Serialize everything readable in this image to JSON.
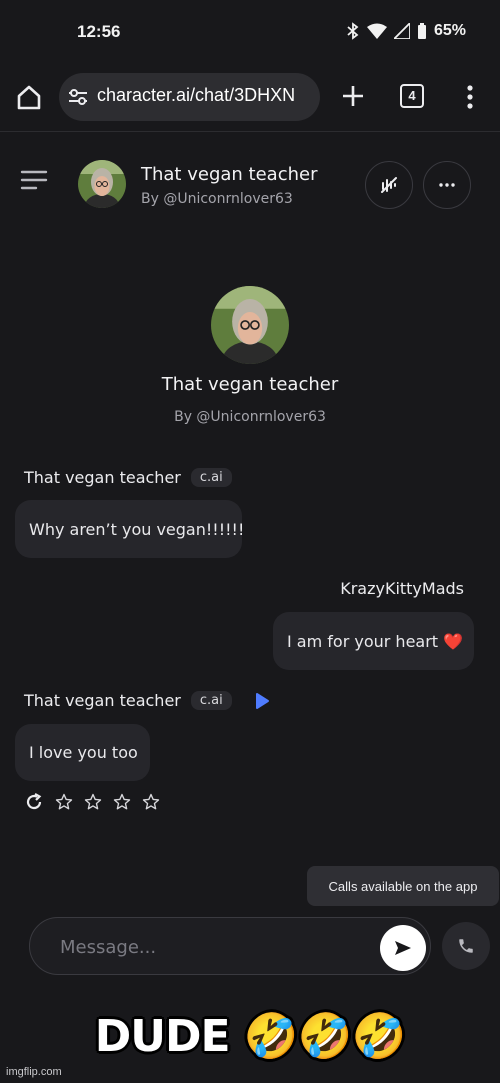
{
  "status_bar": {
    "time": "12:56",
    "battery": "65%"
  },
  "browser": {
    "url": "character.ai/chat/3DHXN",
    "tab_count": "4"
  },
  "chat_header": {
    "character_name": "That vegan teacher",
    "creator": "By @Uniconrnlover63"
  },
  "profile": {
    "name": "That vegan teacher",
    "creator": "By @Uniconrnlover63"
  },
  "messages": [
    {
      "sender": "That vegan teacher",
      "tag": "c.ai",
      "text": "Why aren’t you vegan!!!!!!"
    },
    {
      "sender": "KrazyKittyMads",
      "text": "I am for your heart ❤️"
    },
    {
      "sender": "That vegan teacher",
      "tag": "c.ai",
      "text": "I love you too"
    }
  ],
  "input": {
    "placeholder": "Message..."
  },
  "tooltip": "Calls available on the app",
  "caption": "DUDE 🤣🤣🤣",
  "watermark": "imgflip.com",
  "colors": {
    "background": "#18181b",
    "bubble": "#26262b",
    "accent_play": "#4f7cff",
    "heart": "#e53935"
  }
}
